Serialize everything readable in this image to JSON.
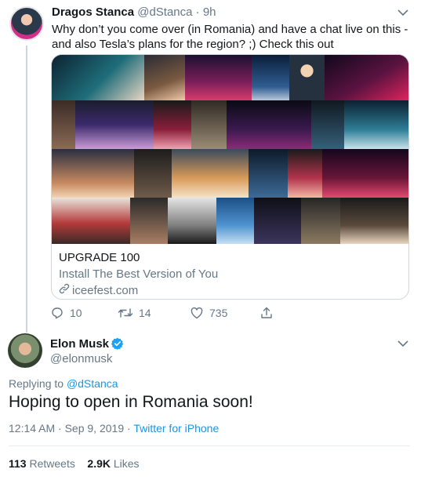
{
  "tweet1": {
    "author_name": "Dragos Stanca",
    "author_handle": "@dStanca",
    "separator": " · ",
    "time": "9h",
    "text": "Why don’t you come over (in Romania) and have a chat live on this - and also Tesla’s plans for the region? ;) Check this out",
    "card": {
      "title": "UPGRADE 100",
      "description": "Install The Best Version of You",
      "domain": "iceefest.com"
    },
    "actions": {
      "replies": "10",
      "retweets": "14",
      "likes": "735"
    },
    "icons": [
      "chevron-down-icon",
      "link-icon",
      "reply-icon",
      "retweet-icon",
      "heart-icon",
      "share-icon"
    ]
  },
  "tweet2": {
    "author_name": "Elon Musk",
    "author_handle": "@elonmusk",
    "replying_prefix": "Replying to ",
    "replying_to": "@dStanca",
    "text": "Hoping to open in Romania soon!",
    "time": "12:14 AM · Sep 9, 2019",
    "meta_separator": " · ",
    "source": "Twitter for iPhone",
    "retweets_count": "113",
    "retweets_label": "Retweets",
    "likes_count": "2.9K",
    "likes_label": "Likes",
    "icons": [
      "verified-badge-icon",
      "chevron-down-icon"
    ]
  },
  "colors": {
    "link": "#1b95e0",
    "muted": "#657786",
    "text": "#14171a",
    "border": "#ccd6dd",
    "verified": "#1da1f2"
  }
}
